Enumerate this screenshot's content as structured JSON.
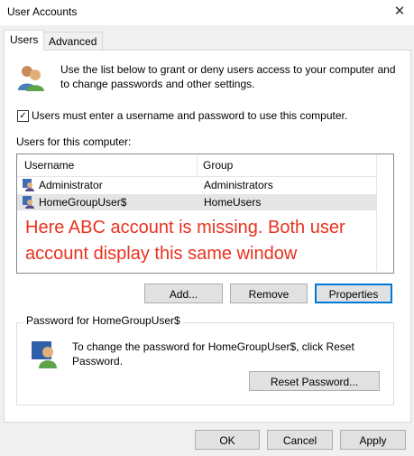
{
  "window": {
    "title": "User Accounts",
    "close_glyph": "✕"
  },
  "tabs": [
    {
      "label": "Users",
      "active": true
    },
    {
      "label": "Advanced",
      "active": false
    }
  ],
  "intro": {
    "line1": "Use the list below to grant or deny users access to your computer and",
    "line2": "to change passwords and other settings.",
    "icon": "users-icon"
  },
  "require_login": {
    "checked": true,
    "label": "Users must enter a username and password to use this computer."
  },
  "users_section": {
    "label": "Users for this computer:"
  },
  "list": {
    "columns": [
      "Username",
      "Group"
    ],
    "rows": [
      {
        "username": "Administrator",
        "group": "Administrators",
        "selected": false
      },
      {
        "username": "HomeGroupUser$",
        "group": "HomeUsers",
        "selected": true
      }
    ]
  },
  "annotation": {
    "line1": "Here ABC account is missing. Both user",
    "line2": "account display this same window",
    "color": "#e8321f"
  },
  "list_buttons": {
    "add": "Add...",
    "remove": "Remove",
    "properties": "Properties"
  },
  "password_group": {
    "label": "Password for HomeGroupUser$",
    "line1": "To change the password for HomeGroupUser$, click Reset",
    "line2": "Password.",
    "reset_button": "Reset Password..."
  },
  "footer_buttons": {
    "ok": "OK",
    "cancel": "Cancel",
    "apply": "Apply"
  },
  "colors": {
    "accent": "#0078d7",
    "selection": "#e5e5e5"
  }
}
